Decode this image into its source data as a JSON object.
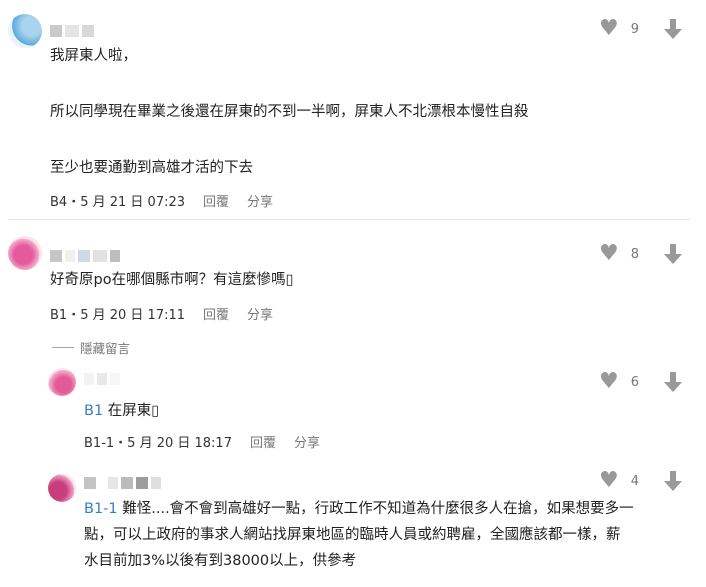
{
  "comments": [
    {
      "lines": [
        "我屏東人啦，",
        "所以同學現在畢業之後還在屏東的不到一半啊，屏東人不北漂根本慢性自殺",
        "至少也要通勤到高雄才活的下去"
      ],
      "floor": "B4",
      "date": "5 月 21 日 07:23",
      "likes": "9"
    },
    {
      "lines": [
        "好奇原po在哪個縣市啊？有這麼慘嗎▯"
      ],
      "floor": "B1",
      "date": "5 月 20 日 17:11",
      "likes": "8"
    }
  ],
  "hide_replies_label": "隱藏留言",
  "replies": [
    {
      "tag": "B1",
      "text": "在屏東▯",
      "floor": "B1-1",
      "date": "5 月 20 日 18:17",
      "likes": "6"
    },
    {
      "tag": "B1-1",
      "lines": [
        " 難怪....會不會到高雄好一點，行政工作不知道為什麼很多人在搶，如果想要多一",
        "點，可以上政府的事求人網站找屏東地區的臨時人員或約聘雇，全國應該都一樣，薪",
        "水目前加3%以後有到38000以上，供參考"
      ],
      "likes": "4"
    }
  ],
  "actions": {
    "reply": "回覆",
    "share": "分享"
  },
  "separator": "・",
  "icons": {
    "like": "heart-icon",
    "dislike": "arrow-down-icon"
  },
  "colors": {
    "tag_link": "#3a7bc8",
    "icon_gray": "#999999"
  }
}
